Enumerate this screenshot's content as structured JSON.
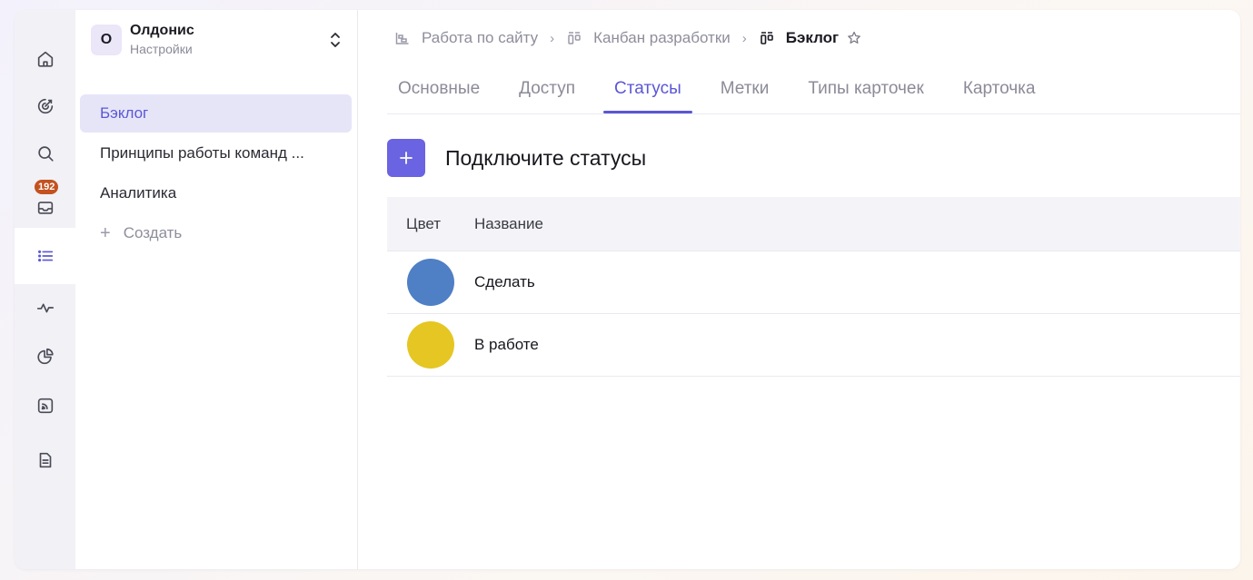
{
  "rail": {
    "items": [
      {
        "icon": "home-icon"
      },
      {
        "icon": "target-icon"
      },
      {
        "icon": "search-icon"
      },
      {
        "icon": "inbox-icon",
        "badge": "192"
      },
      {
        "icon": "list-icon",
        "active": true
      },
      {
        "icon": "activity-icon"
      },
      {
        "icon": "pie-chart-icon"
      },
      {
        "icon": "feed-icon"
      },
      {
        "icon": "document-icon"
      }
    ]
  },
  "workspace": {
    "initial": "О",
    "name": "Олдонис",
    "subtitle": "Настройки"
  },
  "sidebar": {
    "items": [
      {
        "label": "Бэклог",
        "active": true
      },
      {
        "label": "Принципы работы команд ..."
      },
      {
        "label": "Аналитика"
      }
    ],
    "create_label": "Создать"
  },
  "breadcrumb": {
    "project": "Работа по сайту",
    "board": "Канбан разработки",
    "current": "Бэклог"
  },
  "tabs": [
    "Основные",
    "Доступ",
    "Статусы",
    "Метки",
    "Типы карточек",
    "Карточка"
  ],
  "active_tab": "Статусы",
  "statuses_section": {
    "add_title": "Подключите статусы",
    "columns": {
      "color": "Цвет",
      "name": "Название"
    },
    "rows": [
      {
        "name": "Сделать",
        "color": "#4f7fc4"
      },
      {
        "name": "В работе",
        "color": "#e5c623"
      }
    ]
  },
  "colors": {
    "accent": "#6a63e2",
    "active_nav_bg": "#e6e5f8",
    "badge": "#c4521f"
  }
}
